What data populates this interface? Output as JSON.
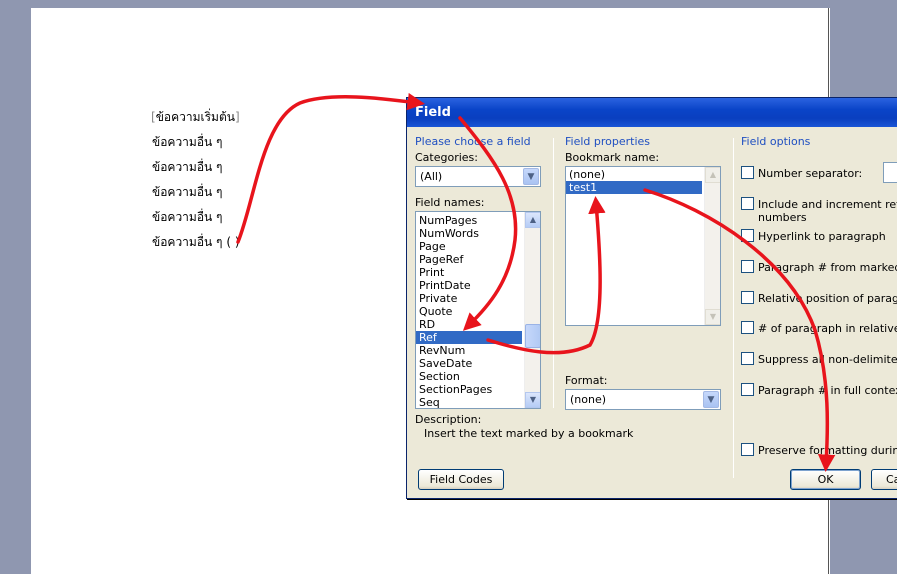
{
  "document": {
    "lines": [
      "ข้อความเริ่มต้น",
      "ข้อความอื่น ๆ",
      "ข้อความอื่น ๆ",
      "ข้อความอื่น ๆ",
      "ข้อความอื่น ๆ",
      "ข้อความอื่น ๆ"
    ],
    "field_marker": "( )"
  },
  "dialog": {
    "title": "Field",
    "choose_field_label": "Please choose a field",
    "categories_label": "Categories:",
    "categories_value": "(All)",
    "field_names_label": "Field names:",
    "field_names": [
      "NumPages",
      "NumWords",
      "Page",
      "PageRef",
      "Print",
      "PrintDate",
      "Private",
      "Quote",
      "RD",
      "Ref",
      "RevNum",
      "SaveDate",
      "Section",
      "SectionPages",
      "Seq"
    ],
    "selected_field": "Ref",
    "description_label": "Description:",
    "description_text": "Insert the text marked by a bookmark",
    "field_properties_label": "Field properties",
    "bookmark_name_label": "Bookmark name:",
    "bookmarks": [
      "(none)",
      "test1"
    ],
    "selected_bookmark": "test1",
    "format_label": "Format:",
    "format_value": "(none)",
    "field_options_label": "Field options",
    "options": [
      "Number separator:",
      "Include and increment referen",
      "numbers",
      "Hyperlink to paragraph",
      "Paragraph # from marked par",
      "Relative position of paragrap",
      "# of paragraph in relative con",
      "Suppress all non-delimiter cha",
      "Paragraph # in full context",
      "Preserve formatting during u"
    ],
    "field_codes_button": "Field Codes",
    "ok_button": "OK",
    "cancel_button": "Ca"
  },
  "colors": {
    "annotation_arrow": "#e8141c",
    "title_bar": "#0a44c8",
    "selection": "#316ac5"
  }
}
